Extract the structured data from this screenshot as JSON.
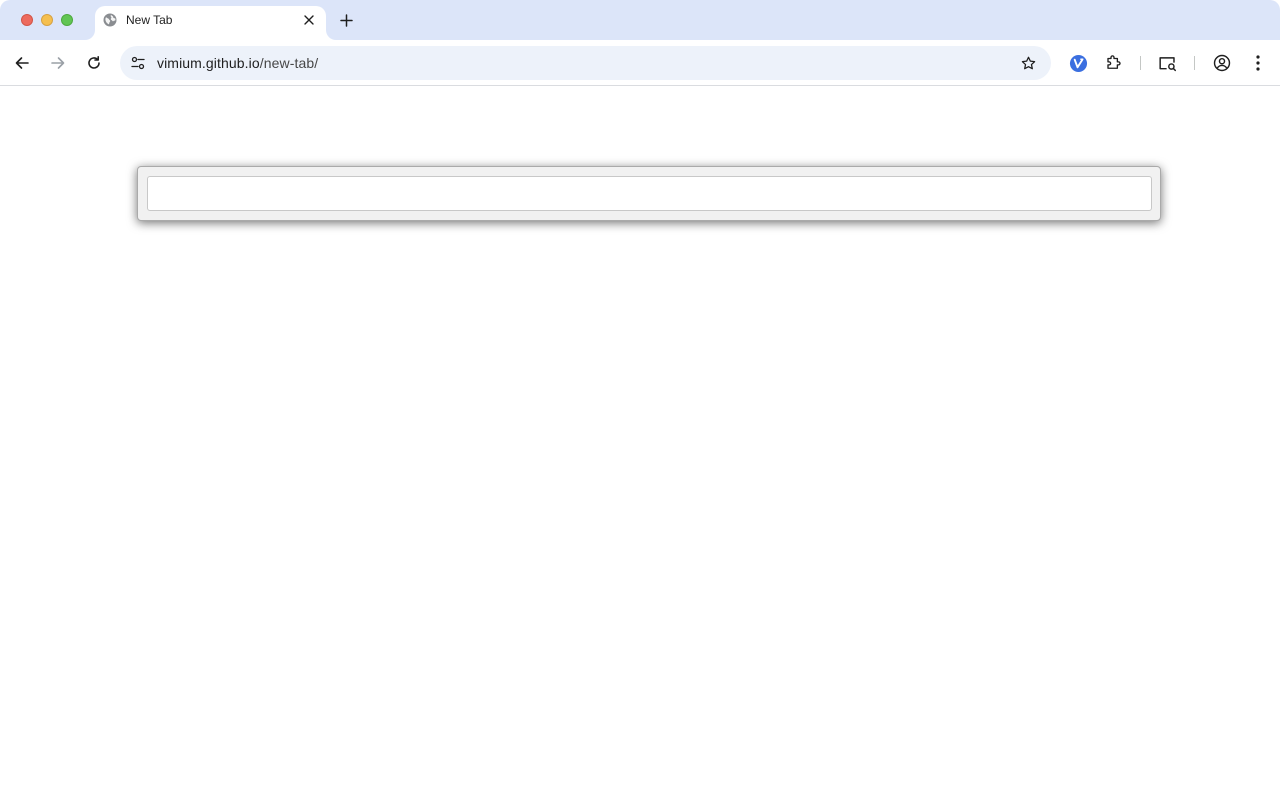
{
  "browser": {
    "tab": {
      "title": "New Tab"
    },
    "address_bar": {
      "host": "vimium.github.io",
      "path": "/new-tab/"
    }
  },
  "vomnibar": {
    "query": "",
    "placeholder": ""
  },
  "colors": {
    "tabstrip_bg": "#dce5f9",
    "omnibox_bg": "#edf2fa",
    "extension_accent": "#3b6fe0",
    "traffic_close": "#ed6a5e",
    "traffic_minimize": "#f5bf4f",
    "traffic_maximize": "#61c554"
  },
  "icons": [
    "globe-icon",
    "close-icon",
    "plus-icon",
    "back-arrow-icon",
    "forward-arrow-icon",
    "reload-icon",
    "tune-icon",
    "star-icon",
    "vimium-extension-icon",
    "puzzle-icon",
    "reading-mode-icon",
    "profile-icon",
    "kebab-menu-icon"
  ]
}
